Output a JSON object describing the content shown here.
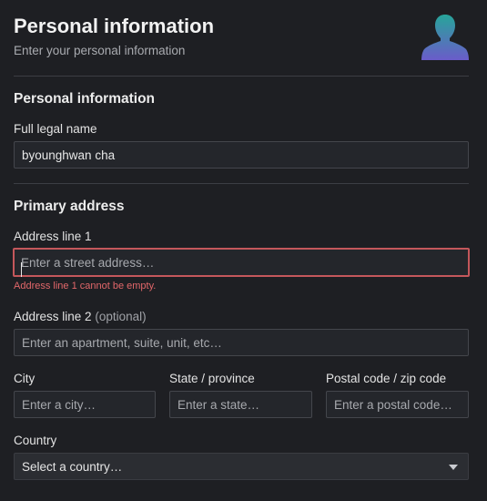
{
  "header": {
    "title": "Personal information",
    "subtitle": "Enter your personal information"
  },
  "personal_section": {
    "title": "Personal information",
    "full_name_label": "Full legal name",
    "full_name_value": "byounghwan cha"
  },
  "address_section": {
    "title": "Primary address",
    "line1_label": "Address line 1",
    "line1_placeholder": "Enter a street address…",
    "line1_error": "Address line 1 cannot be empty.",
    "line2_label": "Address line 2",
    "line2_optional": "(optional)",
    "line2_placeholder": "Enter an apartment, suite, unit, etc…",
    "city_label": "City",
    "city_placeholder": "Enter a city…",
    "state_label": "State / province",
    "state_placeholder": "Enter a state…",
    "postal_label": "Postal code / zip code",
    "postal_placeholder": "Enter a postal code…",
    "country_label": "Country",
    "country_value": "Select a country…"
  },
  "colors": {
    "background": "#1e1f23",
    "error": "#e2676a",
    "avatar_top": "#27a59a",
    "avatar_bottom": "#6a5cc9"
  },
  "icons": {
    "avatar": "user-avatar-icon",
    "dropdown": "chevron-down-icon"
  }
}
